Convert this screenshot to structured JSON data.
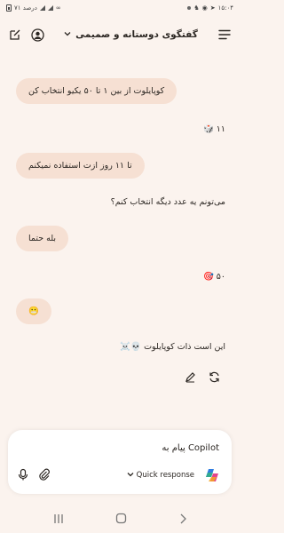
{
  "status_bar": {
    "time": "۱۵:۰۴",
    "battery": "۷۱ درصد"
  },
  "header": {
    "title": "گفتگوی دوستانه و صمیمی",
    "icons": {
      "menu": "hamburger-icon",
      "account": "account-icon",
      "new_chat": "compose-icon",
      "dropdown": "chevron-down-icon"
    }
  },
  "messages": [
    {
      "role": "user",
      "text": "کوپایلوت از بین ۱ تا ۵۰ یکیو انتخاب کن"
    },
    {
      "role": "assistant",
      "text": "🎲 ۱۱"
    },
    {
      "role": "user",
      "text": "تا ۱۱ روز ازت استفاده نمیکنم"
    },
    {
      "role": "assistant",
      "text": "می‌تونم یه عدد دیگه انتخاب کنم؟"
    },
    {
      "role": "user",
      "text": "بله حتما"
    },
    {
      "role": "assistant",
      "text": "🎯 ۵۰"
    },
    {
      "role": "user",
      "text": "😬"
    },
    {
      "role": "assistant",
      "text": "این است ذات کوپایلوت 💀☠️"
    }
  ],
  "message_actions": {
    "edit_icon": "pencil-icon",
    "regenerate_icon": "refresh-icon"
  },
  "composer": {
    "placeholder": "پیام به Copilot",
    "mode_label": "Quick response",
    "icons": {
      "mic": "microphone-icon",
      "attach": "paperclip-icon",
      "logo": "copilot-logo-icon"
    }
  },
  "nav": {
    "icons": [
      "recents-icon",
      "home-icon",
      "back-icon"
    ]
  }
}
